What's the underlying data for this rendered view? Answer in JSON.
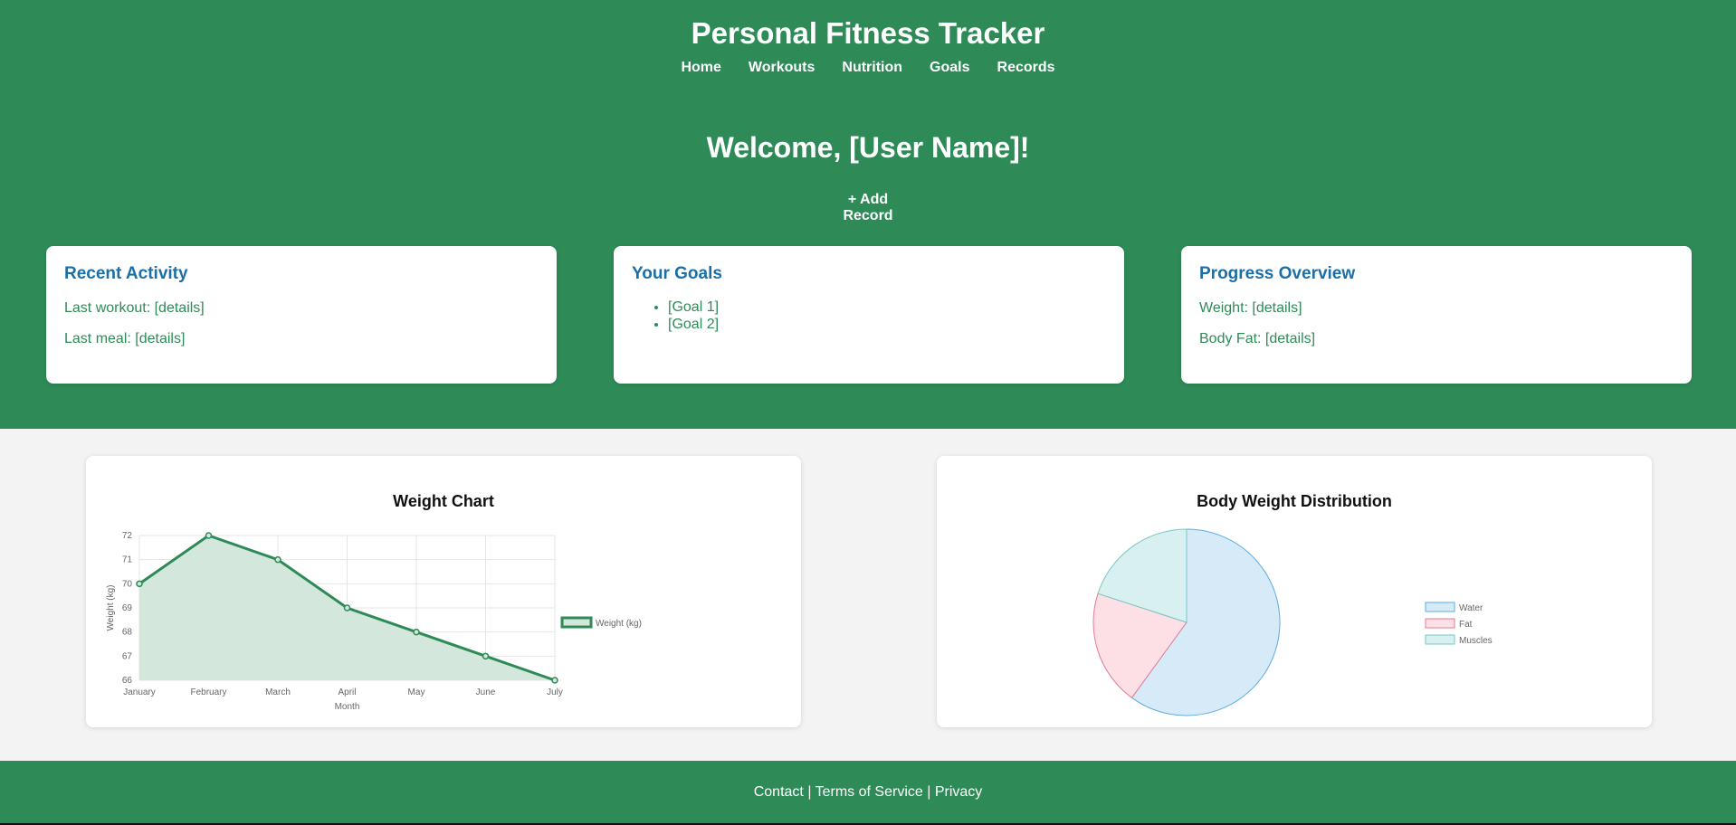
{
  "header": {
    "title": "Personal Fitness Tracker",
    "nav": [
      "Home",
      "Workouts",
      "Nutrition",
      "Goals",
      "Records"
    ]
  },
  "welcome": "Welcome, [User Name]!",
  "add_record_label": "+ Add Record",
  "cards": {
    "recent": {
      "title": "Recent Activity",
      "line1": "Last workout: [details]",
      "line2": "Last meal: [details]"
    },
    "goals": {
      "title": "Your Goals",
      "items": [
        "[Goal 1]",
        "[Goal 2]"
      ]
    },
    "progress": {
      "title": "Progress Overview",
      "line1": "Weight: [details]",
      "line2": "Body Fat: [details]"
    }
  },
  "footer": {
    "contact": "Contact",
    "sep": "|",
    "terms": "Terms of Service",
    "privacy": "Privacy"
  },
  "chart_data": [
    {
      "type": "line",
      "title": "Weight Chart",
      "xlabel": "Month",
      "ylabel": "Weight (kg)",
      "categories": [
        "January",
        "February",
        "March",
        "April",
        "May",
        "June",
        "July"
      ],
      "series": [
        {
          "name": "Weight (kg)",
          "values": [
            70,
            72,
            71,
            69,
            68,
            67,
            66
          ]
        }
      ],
      "ylim": [
        66,
        72
      ],
      "yticks": [
        66,
        67,
        68,
        69,
        70,
        71,
        72
      ],
      "grid": true,
      "fill": true,
      "line_color": "#2e8b57",
      "fill_color": "#d4e7dc",
      "legend": "right"
    },
    {
      "type": "pie",
      "title": "Body Weight Distribution",
      "categories": [
        "Water",
        "Fat",
        "Muscles"
      ],
      "values": [
        60,
        20,
        20
      ],
      "colors": [
        "#d6eaf8",
        "#fde0e6",
        "#d9f0f0"
      ],
      "border_colors": [
        "#5dade2",
        "#e57a92",
        "#76c7c7"
      ],
      "legend": "right"
    }
  ]
}
